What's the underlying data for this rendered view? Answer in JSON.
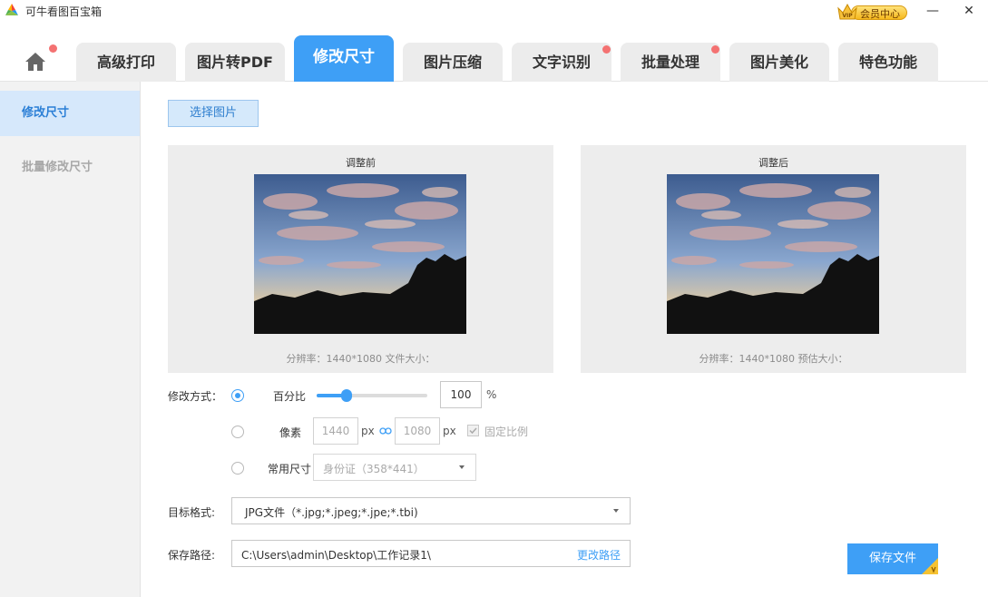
{
  "app": {
    "title": "可牛看图百宝箱",
    "vip_label": "会员中心",
    "vip_badge": "VIP"
  },
  "window": {
    "minimize": "—",
    "close": "✕"
  },
  "tabs": [
    {
      "label": "高级打印",
      "dot": false
    },
    {
      "label": "图片转PDF",
      "dot": false
    },
    {
      "label": "修改尺寸",
      "dot": false,
      "active": true
    },
    {
      "label": "图片压缩",
      "dot": false
    },
    {
      "label": "文字识别",
      "dot": true
    },
    {
      "label": "批量处理",
      "dot": true
    },
    {
      "label": "图片美化",
      "dot": false
    },
    {
      "label": "特色功能",
      "dot": false
    }
  ],
  "sidebar": {
    "items": [
      {
        "label": "修改尺寸",
        "active": true
      },
      {
        "label": "批量修改尺寸",
        "active": false
      }
    ]
  },
  "main": {
    "select_button": "选择图片",
    "before": {
      "title": "调整前",
      "info": "分辨率：1440*1080 文件大小："
    },
    "after": {
      "title": "调整后",
      "info": "分辨率：1440*1080 预估大小："
    },
    "mode_label": "修改方式：",
    "options": {
      "percent_label": "百分比",
      "percent_value": "100",
      "percent_unit": "%",
      "percent_slider": 0.27,
      "pixel_label": "像素",
      "width": "1440",
      "height": "1080",
      "px_unit": "px",
      "lock_ratio_label": "固定比例",
      "preset_label": "常用尺寸",
      "preset_value": "身份证（358*441）"
    },
    "format_label": "目标格式:",
    "format_value": "JPG文件（*.jpg;*.jpeg;*.jpe;*.tbi)",
    "path_label": "保存路径:",
    "path_value": "C:\\Users\\admin\\Desktop\\工作记录1\\",
    "change_path": "更改路径",
    "save_button": "保存文件"
  },
  "colors": {
    "accent": "#3e9ff6",
    "dot": "#f47272"
  }
}
